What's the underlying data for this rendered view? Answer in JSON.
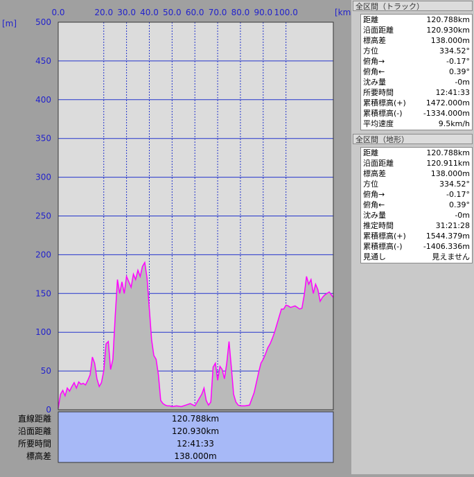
{
  "chart_data": {
    "type": "area",
    "x_unit": "[km]",
    "y_unit": "[m]",
    "x_ticks": [
      "0.0",
      "20.0",
      "30.0",
      "40.0",
      "50.0",
      "60.0",
      "70.0",
      "80.0",
      "90.0",
      "100.0"
    ],
    "x_tick_values": [
      0,
      20,
      30,
      40,
      50,
      60,
      70,
      80,
      90,
      100
    ],
    "y_ticks": [
      "500",
      "450",
      "400",
      "350",
      "300",
      "250",
      "200",
      "150",
      "100",
      "50",
      "0"
    ],
    "xlim": [
      0,
      120.788
    ],
    "ylim": [
      0,
      500
    ],
    "grid": true,
    "colors": {
      "profile_line": "#ff00ff",
      "fill": "#bababa",
      "grid": "#2233cc",
      "axis_labels": "#2222cc",
      "background": "#dcdcdc"
    },
    "series": [
      {
        "x": [
          0,
          1,
          2,
          3,
          4,
          5,
          6,
          7,
          8,
          9,
          10,
          11,
          12,
          13,
          14,
          15,
          16,
          17,
          18,
          19,
          20,
          21,
          22,
          23,
          24,
          25,
          26,
          27,
          28,
          29,
          30,
          31,
          32,
          33,
          34,
          35,
          36,
          37,
          38,
          39,
          40,
          41,
          42,
          43,
          44,
          45,
          46,
          47,
          48,
          49,
          50,
          52,
          54,
          56,
          58,
          60,
          62,
          63,
          64,
          65,
          66,
          67,
          68,
          69,
          70,
          71,
          72,
          73,
          74,
          75,
          76,
          77,
          78,
          79,
          80,
          81,
          82,
          84,
          86,
          88,
          89,
          90,
          91,
          92,
          93,
          94,
          95,
          96,
          97,
          98,
          99,
          100,
          101,
          102,
          103,
          104,
          105,
          106,
          107,
          108,
          109,
          110,
          111,
          112,
          113,
          114,
          115,
          116,
          117,
          118,
          119,
          120,
          120.788
        ],
        "y": [
          2,
          20,
          25,
          18,
          28,
          24,
          30,
          35,
          28,
          36,
          33,
          34,
          32,
          38,
          45,
          68,
          60,
          40,
          30,
          35,
          50,
          85,
          88,
          52,
          65,
          120,
          168,
          150,
          165,
          150,
          172,
          165,
          158,
          175,
          168,
          180,
          172,
          185,
          190,
          170,
          130,
          90,
          70,
          65,
          45,
          12,
          8,
          6,
          5,
          5,
          4,
          5,
          4,
          6,
          8,
          5,
          15,
          20,
          28,
          12,
          6,
          10,
          55,
          60,
          38,
          56,
          52,
          40,
          60,
          88,
          55,
          20,
          10,
          6,
          5,
          5,
          5,
          6,
          22,
          48,
          60,
          65,
          72,
          80,
          85,
          92,
          100,
          110,
          120,
          130,
          130,
          135,
          134,
          132,
          133,
          134,
          132,
          130,
          131,
          148,
          172,
          162,
          168,
          150,
          162,
          155,
          140,
          145,
          148,
          150,
          152,
          148,
          145
        ]
      }
    ]
  },
  "bottom_rows": [
    {
      "label": "直線距離",
      "value": "120.788km"
    },
    {
      "label": "沿面距離",
      "value": "120.930km"
    },
    {
      "label": "所要時間",
      "value": "12:41:33"
    },
    {
      "label": "標高差",
      "value": "138.000m"
    }
  ],
  "panel_track": {
    "title": "全区間（トラック）",
    "rows": [
      {
        "k": "距離",
        "v": "120.788km"
      },
      {
        "k": "沿面距離",
        "v": "120.930km"
      },
      {
        "k": "標高差",
        "v": "138.000m"
      },
      {
        "k": "方位",
        "v": "334.52°"
      },
      {
        "k": "俯角→",
        "v": "-0.17°"
      },
      {
        "k": "俯角←",
        "v": "0.39°"
      },
      {
        "k": "沈み量",
        "v": "-0m"
      },
      {
        "k": "所要時間",
        "v": "12:41:33"
      },
      {
        "k": "累積標高(+)",
        "v": "1472.000m"
      },
      {
        "k": "累積標高(-)",
        "v": "-1334.000m"
      },
      {
        "k": "平均速度",
        "v": "9.5km/h"
      }
    ]
  },
  "panel_terrain": {
    "title": "全区間（地形）",
    "rows": [
      {
        "k": "距離",
        "v": "120.788km"
      },
      {
        "k": "沿面距離",
        "v": "120.911km"
      },
      {
        "k": "標高差",
        "v": "138.000m"
      },
      {
        "k": "方位",
        "v": "334.52°"
      },
      {
        "k": "俯角→",
        "v": "-0.17°"
      },
      {
        "k": "俯角←",
        "v": "0.39°"
      },
      {
        "k": "沈み量",
        "v": "-0m"
      },
      {
        "k": "推定時間",
        "v": "31:21:28"
      },
      {
        "k": "累積標高(+)",
        "v": "1544.379m"
      },
      {
        "k": "累積標高(-)",
        "v": "-1406.336m"
      },
      {
        "k": "見通し",
        "v": "見えません"
      }
    ]
  }
}
